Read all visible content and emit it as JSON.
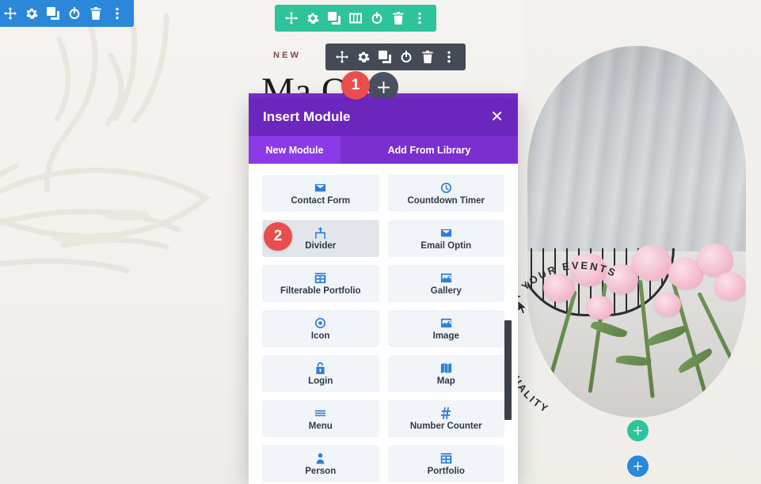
{
  "page": {
    "eyebrow": "NEW",
    "heading": "Ma   Our",
    "circle_text_top": "FOR YOUR EVENTS",
    "circle_text_bottom": "QUALITY"
  },
  "toolbars": {
    "section_toolbar": {
      "color": "#2b87da",
      "icons": [
        "move-icon",
        "gear-icon",
        "duplicate-icon",
        "power-icon",
        "trash-icon",
        "more-options-icon"
      ]
    },
    "row_toolbar": {
      "color": "#2fc39b",
      "icons": [
        "move-icon",
        "gear-icon",
        "duplicate-icon",
        "columns-icon",
        "power-icon",
        "trash-icon",
        "more-options-icon"
      ]
    },
    "module_toolbar": {
      "color": "#444b55",
      "icons": [
        "move-icon",
        "gear-icon",
        "duplicate-icon",
        "power-icon",
        "trash-icon",
        "more-options-icon"
      ]
    }
  },
  "add_buttons": {
    "module_add": "plus-icon",
    "row_add": "plus-icon",
    "section_add": "plus-icon"
  },
  "step_badges": [
    {
      "number": "1"
    },
    {
      "number": "2"
    }
  ],
  "modal": {
    "title": "Insert Module",
    "close_label": "✕",
    "header_color": "#6b27bd",
    "tabs": [
      {
        "label": "New Module",
        "active": true
      },
      {
        "label": "Add From Library",
        "active": false
      }
    ],
    "modules": [
      {
        "label": "Contact Form",
        "icon": "envelope-icon",
        "hover": false
      },
      {
        "label": "Countdown Timer",
        "icon": "clock-icon",
        "hover": false
      },
      {
        "label": "Divider",
        "icon": "divider-icon",
        "hover": true
      },
      {
        "label": "Email Optin",
        "icon": "envelope-icon",
        "hover": false
      },
      {
        "label": "Filterable Portfolio",
        "icon": "grid-icon",
        "hover": false
      },
      {
        "label": "Gallery",
        "icon": "photo-icon",
        "hover": false
      },
      {
        "label": "Icon",
        "icon": "target-icon",
        "hover": false
      },
      {
        "label": "Image",
        "icon": "photo-icon",
        "hover": false
      },
      {
        "label": "Login",
        "icon": "lock-icon",
        "hover": false
      },
      {
        "label": "Map",
        "icon": "map-icon",
        "hover": false
      },
      {
        "label": "Menu",
        "icon": "hamburger-icon",
        "hover": false
      },
      {
        "label": "Number Counter",
        "icon": "hash-icon",
        "hover": false
      },
      {
        "label": "Person",
        "icon": "person-icon",
        "hover": false
      },
      {
        "label": "Portfolio",
        "icon": "grid-icon",
        "hover": false
      }
    ]
  }
}
